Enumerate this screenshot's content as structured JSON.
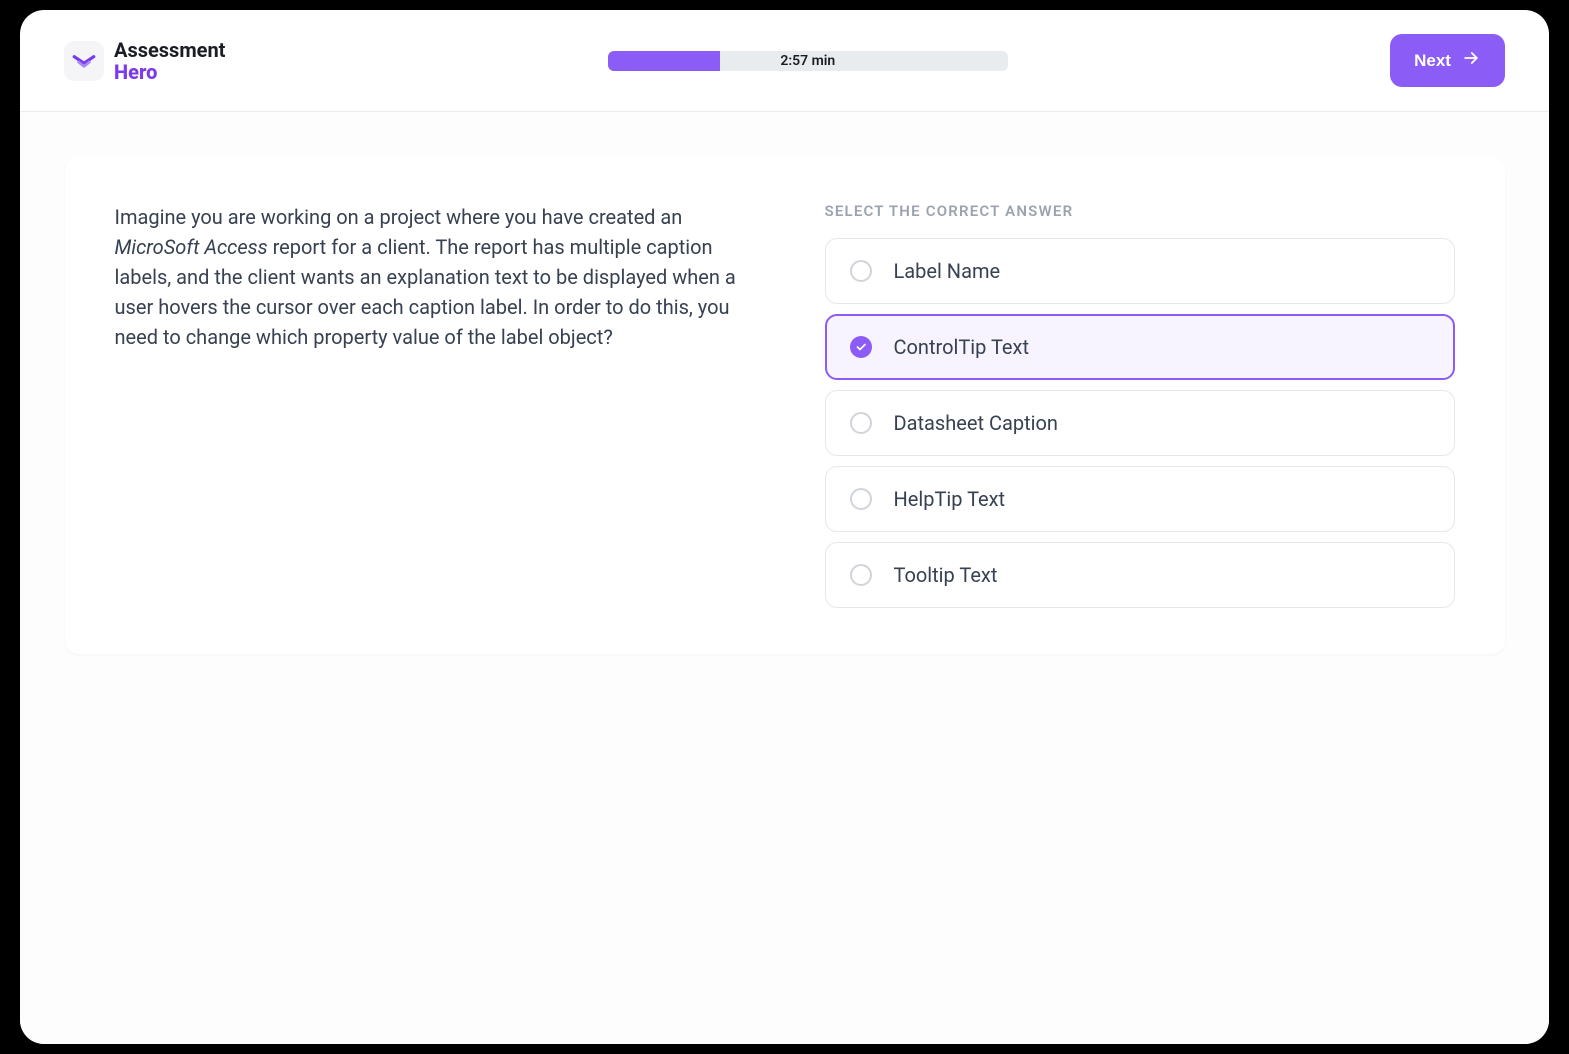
{
  "header": {
    "logo": {
      "line1": "Assessment",
      "line2": "Hero"
    },
    "progress": {
      "percent": 28,
      "time_label": "2:57 min"
    },
    "next_label": "Next"
  },
  "question": {
    "prefix": "Imagine you are working on a project where you have created an ",
    "italic": "MicroSoft Access",
    "suffix": " report for a client. The report has multiple caption labels, and the client wants an explanation text to be displayed when a user hovers the cursor over each caption label. In order to do this, you need to change which property value of the label object?"
  },
  "answers": {
    "heading": "SELECT THE CORRECT ANSWER",
    "selected_index": 1,
    "options": [
      {
        "label": "Label Name"
      },
      {
        "label": "ControlTip Text"
      },
      {
        "label": "Datasheet Caption"
      },
      {
        "label": "HelpTip Text"
      },
      {
        "label": "Tooltip Text"
      }
    ]
  },
  "colors": {
    "accent": "#8b5cf6"
  }
}
